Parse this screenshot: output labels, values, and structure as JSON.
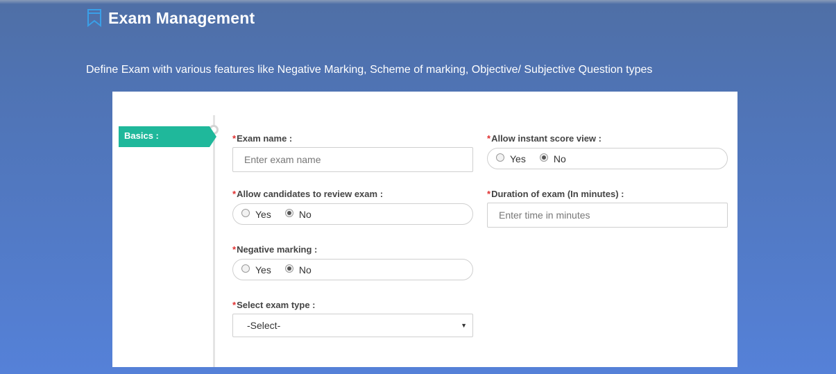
{
  "header": {
    "title": "Exam Management",
    "subtitle": "Define Exam with various features like Negative Marking, Scheme of marking, Objective/ Subjective Question types"
  },
  "steps": [
    {
      "label": "Basics :",
      "active": true
    }
  ],
  "form": {
    "required_mark": "*",
    "exam_name": {
      "label": "Exam name :",
      "placeholder": "Enter exam name",
      "value": ""
    },
    "allow_instant_score_view": {
      "label": "Allow instant score view :",
      "options": [
        "Yes",
        "No"
      ],
      "selected": "No"
    },
    "allow_review": {
      "label": "Allow candidates to review exam :",
      "options": [
        "Yes",
        "No"
      ],
      "selected": "No"
    },
    "duration": {
      "label": "Duration of exam (In minutes) :",
      "placeholder": "Enter time in minutes",
      "value": ""
    },
    "negative_marking": {
      "label": "Negative marking :",
      "options": [
        "Yes",
        "No"
      ],
      "selected": "No"
    },
    "exam_type": {
      "label": "Select exam type :",
      "selected": "-Select-"
    }
  },
  "colors": {
    "accent": "#1fb89b",
    "required": "#e03030",
    "icon": "#3aa0e8"
  }
}
